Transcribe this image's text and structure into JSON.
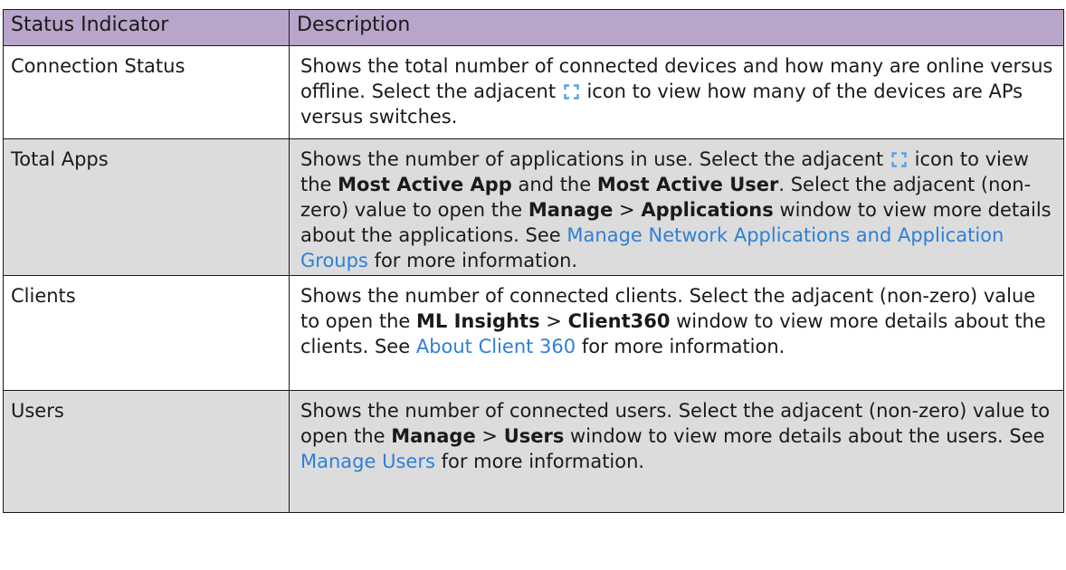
{
  "table": {
    "headers": {
      "indicator": "Status Indicator",
      "description": "Description"
    },
    "rows": {
      "connection_status": {
        "indicator": "Connection Status",
        "desc_1": "Shows the total number of connected devices and how many are online versus offline. Select the adjacent",
        "icon": "expand-icon",
        "desc_2": "icon to view how many of the devices are APs versus switches."
      },
      "total_apps": {
        "indicator": "Total Apps",
        "desc_1": "Shows the number of applications in use. Select the adjacent",
        "icon": "expand-icon",
        "desc_2": "icon to view the",
        "bold_1": "Most Active App",
        "desc_3": "and the",
        "bold_2": "Most Active User",
        "desc_4": ". Select the adjacent (non-zero) value to open the",
        "bold_3": "Manage",
        "sep": ">",
        "bold_4": "Applications",
        "desc_5": "window to view more details about the applications. See",
        "link": "Manage Network Applications and Application Groups",
        "desc_6": "for more information."
      },
      "clients": {
        "indicator": "Clients",
        "desc_1": "Shows the number of connected clients. Select the adjacent (non-zero) value to open the",
        "bold_1": "ML Insights",
        "sep": ">",
        "bold_2": "Client360",
        "desc_2": "window to view more details about the clients. See",
        "link": "About Client 360",
        "desc_3": "for more information."
      },
      "users": {
        "indicator": "Users",
        "desc_1": "Shows the number of connected users. Select the adjacent (non-zero) value to open the",
        "bold_1": "Manage",
        "sep": ">",
        "bold_2": "Users",
        "desc_2": "window to view more details about the users. See",
        "link": "Manage Users",
        "desc_3": "for more information."
      }
    }
  },
  "colors": {
    "header_bg": "#b9a5c9",
    "alt_row_bg": "#dcdcdc",
    "link": "#2e7fd6",
    "border": "#1a1a1a"
  }
}
